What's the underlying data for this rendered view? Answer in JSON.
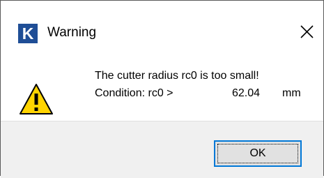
{
  "window": {
    "title": "Warning",
    "app_icon_letter": "K",
    "app_icon_name": "app-k-icon",
    "close_icon_name": "close-icon"
  },
  "message": {
    "icon_name": "warning-icon",
    "line1": "The cutter radius rc0 is too small!",
    "condition_label": "Condition: rc0 >",
    "condition_value": "62.04",
    "condition_unit": "mm"
  },
  "buttons": {
    "ok_label": "OK"
  },
  "colors": {
    "app_icon_bg": "#1f4e96",
    "warning_fill": "#ffd400",
    "focus_border": "#0078d7",
    "footer_bg": "#f0f0f0"
  }
}
